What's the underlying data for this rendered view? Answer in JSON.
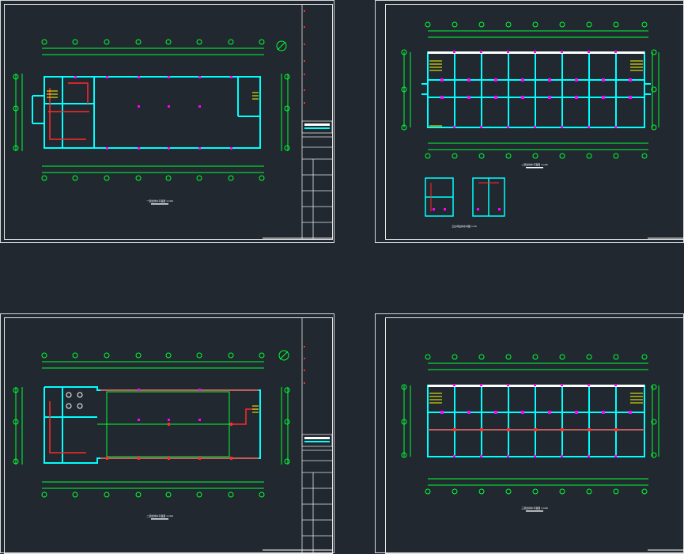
{
  "sheets": [
    {
      "id": "sheet-1",
      "caption": "一层给排水平面图 1:100"
    },
    {
      "id": "sheet-2",
      "caption": "二层给排水平面图 1:100",
      "detail_caption": "卫生间给排水详图 1:50"
    },
    {
      "id": "sheet-3",
      "caption": "二层给排水平面图 1:100"
    },
    {
      "id": "sheet-4",
      "caption": "三层给排水平面图 1:100"
    }
  ],
  "colors": {
    "background": "#212830",
    "border": "#e0e0e0",
    "grid": "#00ff33",
    "wall": "#00ffff",
    "pipe": "#ff2a2a",
    "fixture": "#ff00ff",
    "accent": "#ffff00",
    "text": "#ffffff"
  }
}
